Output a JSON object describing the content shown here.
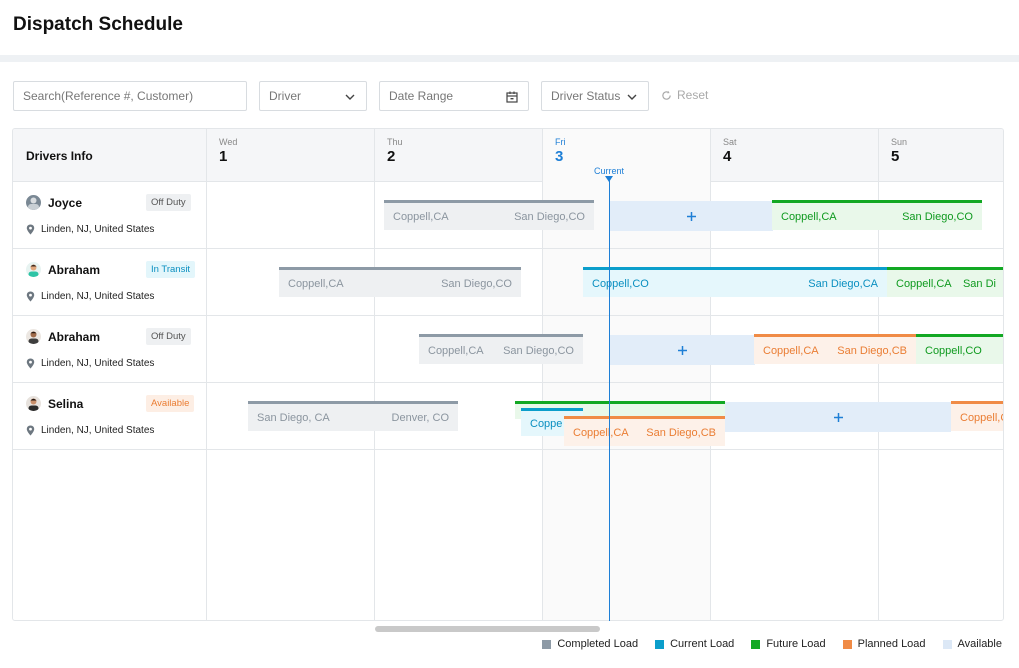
{
  "title": "Dispatch Schedule",
  "filters": {
    "search_placeholder": "Search(Reference #, Customer)",
    "driver": "Driver",
    "date_range": "Date Range",
    "driver_status": "Driver Status",
    "reset": "Reset"
  },
  "grid": {
    "drivers_header": "Drivers Info",
    "days": [
      {
        "name": "Wed",
        "num": "1"
      },
      {
        "name": "Thu",
        "num": "2"
      },
      {
        "name": "Fri",
        "num": "3"
      },
      {
        "name": "Sat",
        "num": "4"
      },
      {
        "name": "Sun",
        "num": "5"
      }
    ],
    "current_label": "Current"
  },
  "drivers": [
    {
      "name": "Joyce",
      "status": "Off Duty",
      "location": "Linden, NJ, United States"
    },
    {
      "name": "Abraham",
      "status": "In Transit",
      "location": "Linden, NJ, United States"
    },
    {
      "name": "Abraham",
      "status": "Off Duty",
      "location": "Linden, NJ, United States"
    },
    {
      "name": "Selina",
      "status": "Available",
      "location": "Linden, NJ, United States"
    }
  ],
  "loads": {
    "r0": [
      {
        "from": "Coppell,CA",
        "to": "San Diego,CO"
      },
      {
        "from": "Coppell,CA",
        "to": "San Diego,CO"
      }
    ],
    "r1": [
      {
        "from": "Coppell,CA",
        "to": "San Diego,CO"
      },
      {
        "from": "Coppell,CO",
        "to": "San Diego,CA"
      },
      {
        "from": "Coppell,CA",
        "to": "San Di"
      }
    ],
    "r2": [
      {
        "from": "Coppell,CA",
        "to": "San Diego,CO"
      },
      {
        "from": "Coppell,CA",
        "to": "San Diego,CB"
      },
      {
        "from": "Coppell,CO",
        "to": ""
      }
    ],
    "r3": [
      {
        "from": "San Diego, CA",
        "to": "Denver, CO"
      },
      {
        "from": "Coppe",
        "to": ""
      },
      {
        "from": "Coppell,CA",
        "to": "San Diego,CB"
      },
      {
        "from": "Coppell,C",
        "to": ""
      }
    ]
  },
  "legend": [
    {
      "label": "Completed Load",
      "color": "#8d9aa6"
    },
    {
      "label": "Current Load",
      "color": "#0b9ecb"
    },
    {
      "label": "Future Load",
      "color": "#12a823"
    },
    {
      "label": "Planned Load",
      "color": "#f08b46"
    },
    {
      "label": "Available",
      "color": "#dce8f6"
    }
  ],
  "colors": {
    "accent": "#1e7fd6",
    "off_duty_bg": "#eef0f2",
    "in_transit_bg": "#e3f6fb",
    "available_bg": "#fdeee4"
  }
}
